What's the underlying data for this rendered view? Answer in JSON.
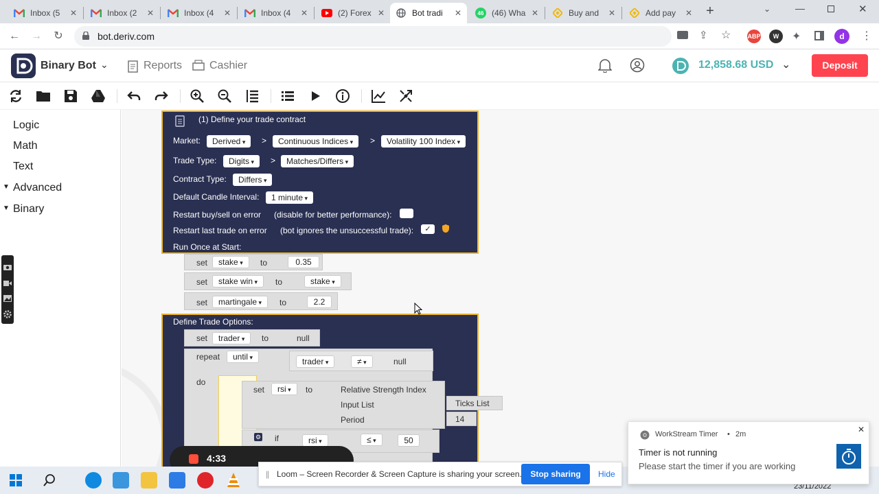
{
  "browser": {
    "tabs": [
      {
        "label": "Inbox (5",
        "icon": "gmail-icon"
      },
      {
        "label": "Inbox (2",
        "icon": "gmail-icon"
      },
      {
        "label": "Inbox (4",
        "icon": "gmail-icon"
      },
      {
        "label": "Inbox (4",
        "icon": "gmail-icon"
      },
      {
        "label": "(2) Forex",
        "icon": "youtube-icon"
      },
      {
        "label": "Bot tradi",
        "icon": "globe-icon"
      },
      {
        "label": "(46) Wha",
        "icon": "whatsapp-icon",
        "badge": "46"
      },
      {
        "label": "Buy and",
        "icon": "binance-icon"
      },
      {
        "label": "Add pay",
        "icon": "binance-icon"
      }
    ],
    "url": "bot.deriv.com",
    "profile_initial": "d",
    "abp_label": "ABP"
  },
  "header": {
    "app_name": "Binary Bot",
    "reports": "Reports",
    "cashier": "Cashier",
    "balance": "12,858.68 USD",
    "deposit": "Deposit"
  },
  "sidebar": {
    "categories": [
      "Logic",
      "Math",
      "Text",
      "Advanced",
      "Binary"
    ]
  },
  "trade_block": {
    "title": "(1) Define your trade contract",
    "market_label": "Market:",
    "market": "Derived",
    "submarket": "Continuous Indices",
    "symbol": "Volatility 100 Index",
    "arrow": ">",
    "trade_type_label": "Trade Type:",
    "trade_type": "Digits",
    "trade_subtype": "Matches/Differs",
    "contract_type_label": "Contract Type:",
    "contract_type": "Differs",
    "candle_label": "Default Candle Interval:",
    "candle": "1 minute",
    "restart_label": "Restart buy/sell on error",
    "restart_note": "(disable for better performance):",
    "restart_last_label": "Restart last trade on error",
    "restart_last_note": "(bot ignores the unsuccessful trade):",
    "run_once_label": "Run Once at Start:",
    "define_options_label": "Define Trade Options:"
  },
  "vars": {
    "set": "set",
    "to": "to",
    "stake": "stake",
    "stake_val": "0.35",
    "stake_win": "stake win",
    "martingale": "martingale",
    "martingale_val": "2.2",
    "trader": "trader",
    "null": "null",
    "repeat": "repeat",
    "until": "until",
    "neq": "≠",
    "do": "do",
    "rsi": "rsi",
    "rsi_label": "Relative Strength Index",
    "input_list": "Input List",
    "ticks_list": "Ticks List",
    "period": "Period",
    "period_val": "14",
    "if": "if",
    "lte": "≤",
    "rsi_cmp": "50"
  },
  "recorder": {
    "time": "4:33"
  },
  "loom": {
    "message": "Loom – Screen Recorder & Screen Capture is sharing your screen.",
    "stop": "Stop sharing",
    "hide": "Hide"
  },
  "toast": {
    "app": "WorkStream Timer",
    "age": "2m",
    "sep": "•",
    "title": "Timer is not running",
    "body": "Please start the timer if you are working"
  },
  "taskbar": {
    "date": "23/11/2022"
  }
}
